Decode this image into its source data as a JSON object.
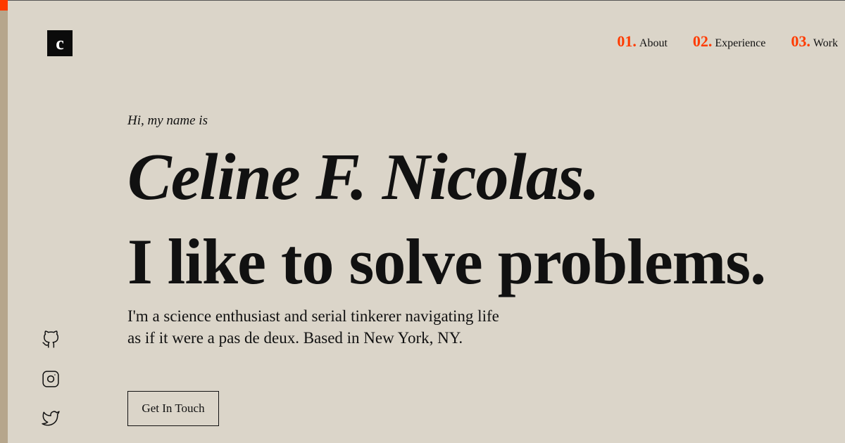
{
  "logo": {
    "letter": "c"
  },
  "nav": {
    "items": [
      {
        "num": "01.",
        "label": "About"
      },
      {
        "num": "02.",
        "label": "Experience"
      },
      {
        "num": "03.",
        "label": "Work"
      }
    ]
  },
  "hero": {
    "greeting": "Hi, my name is",
    "name": "Celine F. Nicolas.",
    "tagline": "I like to solve problems.",
    "bio": "I'm a science enthusiast and serial tinkerer navigating life as if it were a pas de deux. Based in New York, NY.",
    "cta_label": "Get In Touch"
  },
  "social": {
    "icons": [
      "github-icon",
      "instagram-icon",
      "twitter-icon"
    ]
  },
  "colors": {
    "background": "#dbd5c9",
    "accent": "#ff3b00",
    "rail": "#b6a68c",
    "text": "#111111"
  }
}
